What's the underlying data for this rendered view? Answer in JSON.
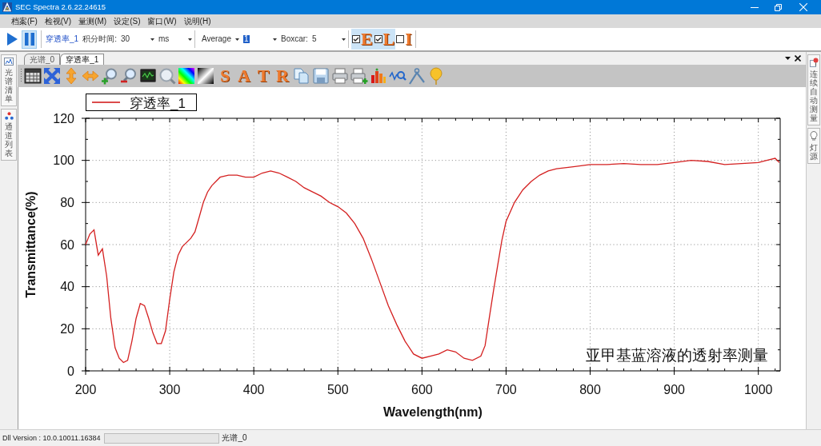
{
  "window": {
    "title": "SEC Spectra 2.6.22.24615"
  },
  "menu": [
    "档案(F)",
    "检视(V)",
    "量测(M)",
    "设定(S)",
    "窗口(W)",
    "说明(H)"
  ],
  "toolbar": [
    [
      {
        "kind": "play",
        "pressed": false
      },
      {
        "kind": "pause",
        "pressed": true
      }
    ],
    [
      {
        "kind": "link",
        "text": "穿透率_1"
      },
      {
        "kind": "label",
        "text": "积分时间:"
      },
      {
        "kind": "combo",
        "value": "30",
        "highlighted": false
      },
      {
        "kind": "combo",
        "value": "ms",
        "highlighted": false
      }
    ],
    [
      {
        "kind": "combo",
        "value": "Average",
        "highlighted": false
      },
      {
        "kind": "combo",
        "value": "1",
        "highlighted": true
      },
      {
        "kind": "label",
        "text": "Boxcar:"
      },
      {
        "kind": "combo",
        "value": "5",
        "highlighted": false
      }
    ],
    [
      {
        "kind": "toggle",
        "label": "E",
        "checked": true
      },
      {
        "kind": "toggle",
        "label": "L",
        "checked": true
      },
      {
        "kind": "toggle",
        "label": "I",
        "checked": false
      }
    ]
  ],
  "left_panel": {
    "tabs": [
      {
        "kind": "chart",
        "label": "光谱清单"
      },
      {
        "kind": "dots",
        "label": "通道列表"
      }
    ]
  },
  "document_tabs": [
    {
      "label": "光谱_0",
      "selected": false
    },
    {
      "label": "穿透率_1",
      "selected": true
    }
  ],
  "chart_toolbar": [
    {
      "kind": "table"
    },
    {
      "kind": "fit"
    },
    {
      "kind": "vertical"
    },
    {
      "kind": "horizontal"
    },
    {
      "kind": "zoom_in"
    },
    {
      "kind": "zoom_out"
    },
    {
      "kind": "monitor"
    },
    {
      "kind": "magnifier"
    },
    {
      "kind": "spectrum"
    },
    {
      "kind": "gradient"
    },
    {
      "kind": "letter",
      "label": "S"
    },
    {
      "kind": "letter",
      "label": "A"
    },
    {
      "kind": "letter",
      "label": "T"
    },
    {
      "kind": "letter",
      "label": "R"
    },
    {
      "kind": "copy"
    },
    {
      "kind": "save"
    },
    {
      "kind": "print"
    },
    {
      "kind": "print_add"
    },
    {
      "kind": "peaks"
    },
    {
      "kind": "wave_search"
    },
    {
      "kind": "compass"
    },
    {
      "kind": "pin"
    }
  ],
  "chart": {
    "chart_data": {
      "type": "line",
      "xlabel": "Wavelength(nm)",
      "ylabel": "Transmittance(%)",
      "xlim": [
        200,
        1026
      ],
      "ylim": [
        0,
        120
      ],
      "xticks": [
        200,
        300,
        400,
        500,
        600,
        700,
        800,
        900,
        1000
      ],
      "yticks": [
        0,
        20,
        40,
        60,
        80,
        100,
        120
      ],
      "grid": true,
      "x": [
        200,
        205,
        210,
        215,
        220,
        225,
        230,
        235,
        240,
        245,
        250,
        255,
        260,
        265,
        270,
        275,
        280,
        285,
        290,
        295,
        300,
        305,
        310,
        315,
        320,
        325,
        330,
        335,
        340,
        345,
        350,
        360,
        370,
        380,
        390,
        400,
        410,
        420,
        430,
        440,
        450,
        460,
        470,
        480,
        490,
        500,
        510,
        520,
        530,
        540,
        550,
        560,
        570,
        580,
        590,
        600,
        610,
        620,
        630,
        640,
        650,
        660,
        670,
        675,
        680,
        685,
        690,
        695,
        700,
        710,
        720,
        730,
        740,
        750,
        760,
        770,
        780,
        800,
        820,
        840,
        860,
        880,
        900,
        920,
        940,
        960,
        980,
        1000,
        1010,
        1020,
        1025
      ],
      "series": [
        {
          "name": "穿透率_1",
          "color": "#d42020",
          "values": [
            60,
            65,
            67,
            55,
            58,
            45,
            25,
            11,
            6,
            4,
            5,
            14,
            25,
            32,
            31,
            25,
            18,
            13,
            13,
            19,
            34,
            47,
            55,
            59,
            61,
            63,
            66,
            73,
            80,
            85,
            88,
            92,
            93,
            93,
            92,
            92,
            94,
            95,
            94,
            92,
            90,
            87,
            85,
            83,
            80,
            78,
            75,
            70,
            63,
            53,
            42,
            31,
            22,
            14,
            8,
            6,
            7,
            8,
            10,
            9,
            6,
            5,
            7,
            12,
            25,
            38,
            50,
            62,
            71,
            80,
            86,
            90,
            93,
            95,
            96,
            96.5,
            97,
            98,
            98,
            98.5,
            98,
            98,
            99,
            100,
            99.5,
            98,
            98.5,
            99,
            100,
            101,
            99
          ]
        }
      ],
      "annotations": [
        "亚甲基蓝溶液的透射率测量"
      ]
    }
  },
  "right_panel": {
    "tabs": [
      {
        "kind": "pin",
        "label": "连续自动测量"
      },
      {
        "kind": "bulb",
        "label": "灯源"
      }
    ]
  },
  "status_bar": {
    "version": "Dll Version : 10.0.10011.16384",
    "progress": {
      "level": 0
    },
    "spectrum": "光谱_0"
  }
}
